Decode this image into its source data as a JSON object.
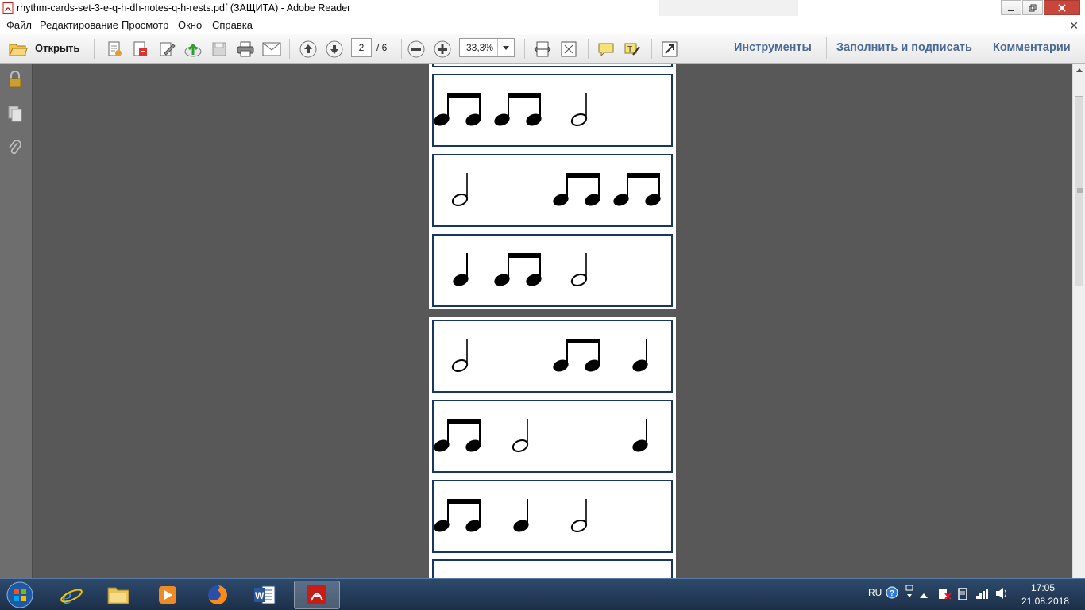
{
  "window": {
    "title": "rhythm-cards-set-3-e-q-h-dh-notes-q-h-rests.pdf (ЗАЩИТА) - Adobe Reader"
  },
  "menu": {
    "items": [
      "Файл",
      "Редактирование",
      "Просмотр",
      "Окно",
      "Справка"
    ]
  },
  "toolbar": {
    "open_label": "Открыть",
    "page_current": "2",
    "page_total": "/ 6",
    "zoom": "33,3%"
  },
  "right_tabs": {
    "tools": "Инструменты",
    "fill_sign": "Заполнить и подписать",
    "comments": "Комментарии"
  },
  "document": {
    "cards": [
      [
        "eighth-pair",
        "eighth-pair",
        "half"
      ],
      [
        "half",
        "eighth-pair",
        "eighth-pair"
      ],
      [
        "quarter",
        "eighth-pair",
        "half"
      ],
      [
        "half",
        "eighth-pair",
        "quarter"
      ],
      [
        "eighth-pair",
        "half",
        "quarter"
      ],
      [
        "eighth-pair",
        "quarter",
        "half"
      ]
    ]
  },
  "taskbar": {
    "apps": [
      "internet-explorer-icon",
      "file-explorer-icon",
      "media-player-icon",
      "firefox-icon",
      "word-icon",
      "adobe-reader-icon"
    ],
    "language": "RU",
    "time": "17:05",
    "date": "21.08.2018"
  },
  "colors": {
    "accent_tab": "#4a6a93",
    "card_border": "#17375e",
    "workspace": "#585858"
  }
}
